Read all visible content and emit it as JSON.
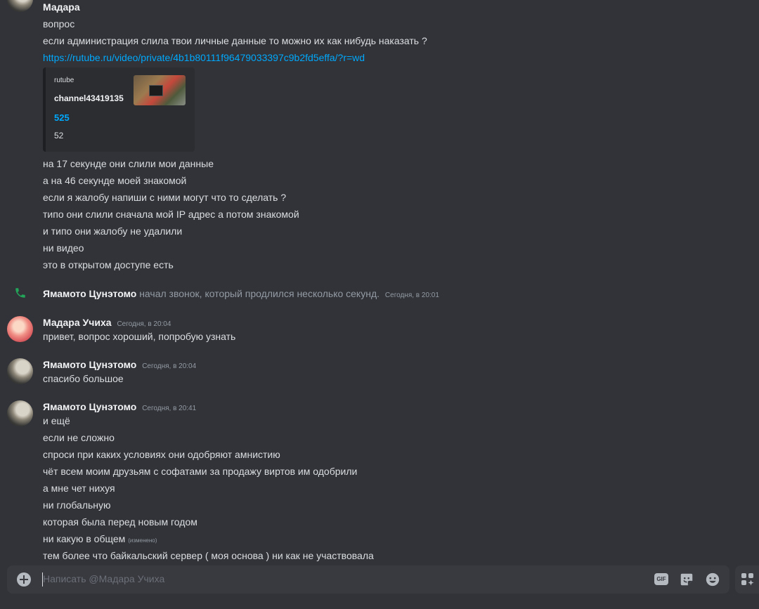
{
  "messages": {
    "m1": {
      "author": "Мадара",
      "lines": [
        "вопрос",
        "если администрация слила твои личные данные то можно их как нибудь наказать ?"
      ],
      "link": "https://rutube.ru/video/private/4b1b80111f96479033397c9b2fd5effa/?r=wd",
      "embed": {
        "provider": "rutube",
        "title": "channel43419135",
        "stat_blue": "525",
        "stat": "52"
      },
      "lines_after": [
        "на 17 секунде они слили мои данные",
        "а на 46 секунде моей знакомой",
        "если я жалобу напиши с ними могут что то сделать ?",
        "типо они слили сначала мой IP адрес а потом знакомой",
        "и типо они жалобу не удалили",
        "ни видео",
        "это в открытом доступе есть"
      ]
    },
    "call": {
      "author": "Ямамото Цунэтомо",
      "text": "начал звонок, который продлился несколько секунд.",
      "time": "Сегодня, в 20:01"
    },
    "m2": {
      "author": "Мадара Учиха",
      "time": "Сегодня, в 20:04",
      "text": "привет, вопрос хороший, попробую узнать"
    },
    "m3": {
      "author": "Ямамото Цунэтомо",
      "time": "Сегодня, в 20:04",
      "text": "спасибо большое"
    },
    "m4": {
      "author": "Ямамото Цунэтомо",
      "time": "Сегодня, в 20:41",
      "lines": [
        "и ещё",
        "если не сложно",
        "спроси при каких условиях они одобряют амнистию",
        "чёт всем моим друзьям с софатами за продажу виртов им одобрили",
        "а  мне чет нихуя",
        "ни глобальную",
        "которая была перед новым годом",
        "ни какую в общем",
        "тем более что байкальский сервер ( моя основа ) ни как не участвовала"
      ],
      "edited": "(изменено)"
    }
  },
  "composer": {
    "placeholder": "Написать @Мадара Учиха",
    "gif_label": "GIF"
  },
  "icons": {
    "add": "plus-circle-icon",
    "gif": "gif-icon",
    "sticker": "sticker-icon",
    "emoji": "emoji-icon",
    "apps": "apps-icon",
    "call": "phone-icon"
  },
  "colors": {
    "background": "#313338",
    "link": "#00a8fc",
    "call_icon": "#23a559",
    "muted": "#949ba4"
  }
}
